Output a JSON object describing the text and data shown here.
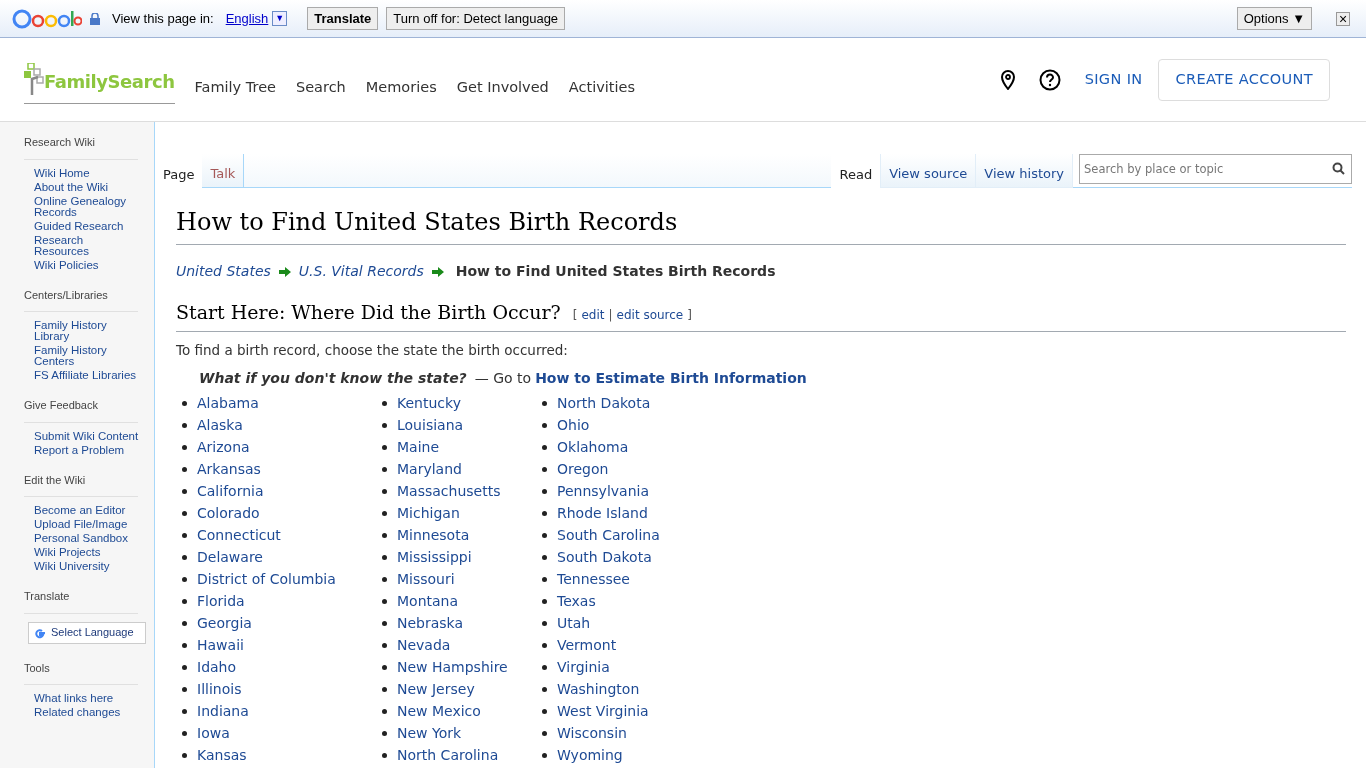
{
  "translate_bar": {
    "prompt": "View this page in:",
    "language": "English",
    "dropdown": "▼",
    "translate_button": "Translate",
    "turn_off_button": "Turn off for: Detect language",
    "options_button": "Options ▼",
    "close": "×"
  },
  "header": {
    "logo": "FamilySearch",
    "nav": [
      "Family Tree",
      "Search",
      "Memories",
      "Get Involved",
      "Activities"
    ],
    "sign_in": "SIGN IN",
    "create_account": "CREATE ACCOUNT"
  },
  "sidebar": {
    "sections": [
      {
        "title": "Research Wiki",
        "items": [
          "Wiki Home",
          "About the Wiki",
          "Online Genealogy Records",
          "Guided Research",
          "Research Resources",
          "Wiki Policies"
        ]
      },
      {
        "title": "Centers/Libraries",
        "items": [
          "Family History Library",
          "Family History Centers",
          "FS Affiliate Libraries"
        ]
      },
      {
        "title": "Give Feedback",
        "items": [
          "Submit Wiki Content",
          "Report a Problem"
        ]
      },
      {
        "title": "Edit the Wiki",
        "items": [
          "Become an Editor",
          "Upload File/Image",
          "Personal Sandbox",
          "Wiki Projects",
          "Wiki University"
        ]
      },
      {
        "title": "Translate",
        "widget": "Select Language"
      },
      {
        "title": "Tools",
        "items": [
          "What links here",
          "Related changes"
        ]
      }
    ]
  },
  "page_tabs": [
    {
      "label": "Page",
      "selected": true
    },
    {
      "label": "Talk",
      "selected": false
    }
  ],
  "view_tabs": [
    {
      "label": "Read",
      "selected": true
    },
    {
      "label": "View source",
      "selected": false
    },
    {
      "label": "View history",
      "selected": false
    }
  ],
  "search": {
    "placeholder": "Search by place or topic"
  },
  "title": "How to Find United States Birth Records",
  "breadcrumbs": [
    {
      "label": "United States",
      "current": false
    },
    {
      "label": "U.S. Vital Records",
      "current": false
    },
    {
      "label": "How to Find United States Birth Records",
      "current": true
    }
  ],
  "section": {
    "heading": "Start Here: Where Did the Birth Occur?",
    "open_bracket": "[",
    "edit": "edit",
    "separator": "|",
    "edit_source": "edit source",
    "close_bracket": "]"
  },
  "intro": "To find a birth record, choose the state the birth occurred:",
  "note": {
    "question": "What if you don't know the state?",
    "text": "— Go to",
    "link": "How to Estimate Birth Information"
  },
  "state_columns": [
    [
      "Alabama",
      "Alaska",
      "Arizona",
      "Arkansas",
      "California",
      "Colorado",
      "Connecticut",
      "Delaware",
      "District of Columbia",
      "Florida",
      "Georgia",
      "Hawaii",
      "Idaho",
      "Illinois",
      "Indiana",
      "Iowa",
      "Kansas"
    ],
    [
      "Kentucky",
      "Louisiana",
      "Maine",
      "Maryland",
      "Massachusetts",
      "Michigan",
      "Minnesota",
      "Mississippi",
      "Missouri",
      "Montana",
      "Nebraska",
      "Nevada",
      "New Hampshire",
      "New Jersey",
      "New Mexico",
      "New York",
      "North Carolina"
    ],
    [
      "North Dakota",
      "Ohio",
      "Oklahoma",
      "Oregon",
      "Pennsylvania",
      "Rhode Island",
      "South Carolina",
      "South Dakota",
      "Tennessee",
      "Texas",
      "Utah",
      "Vermont",
      "Virginia",
      "Washington",
      "West Virginia",
      "Wisconsin",
      "Wyoming"
    ]
  ]
}
